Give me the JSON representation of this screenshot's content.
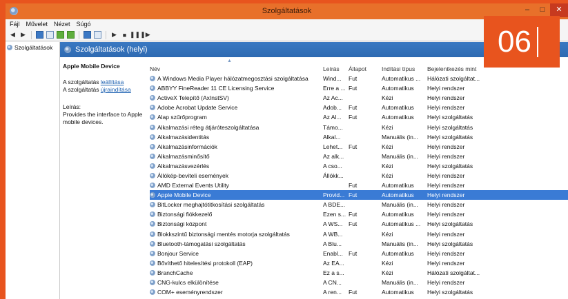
{
  "window": {
    "title": "Szolgáltatások",
    "controls": [
      "–",
      "□",
      "✕"
    ]
  },
  "menu": [
    "Fájl",
    "Művelet",
    "Nézet",
    "Súgó"
  ],
  "tree": {
    "item": "Szolgáltatások"
  },
  "header": {
    "title": "Szolgáltatások (helyi)"
  },
  "description": {
    "service_name": "Apple Mobile Device",
    "stop_prefix": "A szolgáltatás ",
    "stop_link": "leállítása",
    "restart_prefix": "A szolgáltatás ",
    "restart_link": "újraindítása",
    "desc_label": "Leírás:",
    "desc_text": "Provides the interface to Apple mobile devices."
  },
  "columns": [
    "Név",
    "Leírás",
    "Állapot",
    "Indítási típus",
    "Bejelentkezés mint"
  ],
  "rows": [
    {
      "name": "A Windows Media Player hálózatmegosztási szolgáltatása",
      "desc": "Wind...",
      "status": "Fut",
      "startup": "Automatikus ...",
      "logon": "Hálózati szolgáltat..."
    },
    {
      "name": "ABBYY FineReader 11 CE Licensing Service",
      "desc": "Erre a ...",
      "status": "Fut",
      "startup": "Automatikus",
      "logon": "Helyi rendszer"
    },
    {
      "name": "ActiveX Telepítő (AxInstSV)",
      "desc": "Az Ac...",
      "status": "",
      "startup": "Kézi",
      "logon": "Helyi rendszer"
    },
    {
      "name": "Adobe Acrobat Update Service",
      "desc": "Adob...",
      "status": "Fut",
      "startup": "Automatikus",
      "logon": "Helyi rendszer"
    },
    {
      "name": "Alap szűrőprogram",
      "desc": "Az Al...",
      "status": "Fut",
      "startup": "Automatikus",
      "logon": "Helyi szolgáltatás"
    },
    {
      "name": "Alkalmazási réteg átjáróteszolgáltatása",
      "desc": "Támo...",
      "status": "",
      "startup": "Kézi",
      "logon": "Helyi szolgáltatás"
    },
    {
      "name": "Alkalmazásidentitás",
      "desc": "Alkal...",
      "status": "",
      "startup": "Manuális (in...",
      "logon": "Helyi szolgáltatás"
    },
    {
      "name": "Alkalmazásinformációk",
      "desc": "Lehet...",
      "status": "Fut",
      "startup": "Kézi",
      "logon": "Helyi rendszer"
    },
    {
      "name": "Alkalmazásminősítő",
      "desc": "Az alk...",
      "status": "",
      "startup": "Manuális (in...",
      "logon": "Helyi rendszer"
    },
    {
      "name": "Alkalmazásvezérlés",
      "desc": "A cso...",
      "status": "",
      "startup": "Kézi",
      "logon": "Helyi szolgáltatás"
    },
    {
      "name": "Állókép-beviteli események",
      "desc": "Állókk...",
      "status": "",
      "startup": "Kézi",
      "logon": "Helyi rendszer"
    },
    {
      "name": "AMD External Events Utility",
      "desc": "",
      "status": "Fut",
      "startup": "Automatikus",
      "logon": "Helyi rendszer"
    },
    {
      "name": "Apple Mobile Device",
      "desc": "Provid...",
      "status": "Fut",
      "startup": "Automatikus",
      "logon": "Helyi rendszer",
      "selected": true
    },
    {
      "name": "BitLocker meghajtótitkosítási szolgáltatás",
      "desc": "A BDE...",
      "status": "",
      "startup": "Manuális (in...",
      "logon": "Helyi rendszer"
    },
    {
      "name": "Biztonsági fiókkezelő",
      "desc": "Ezen s...",
      "status": "Fut",
      "startup": "Automatikus",
      "logon": "Helyi rendszer"
    },
    {
      "name": "Biztonsági központ",
      "desc": "A WS...",
      "status": "Fut",
      "startup": "Automatikus ...",
      "logon": "Helyi szolgáltatás"
    },
    {
      "name": "Blokkszintű biztonsági mentés motorja szolgáltatás",
      "desc": "A WB...",
      "status": "",
      "startup": "Kézi",
      "logon": "Helyi rendszer"
    },
    {
      "name": "Bluetooth-támogatási szolgáltatás",
      "desc": "A Blu...",
      "status": "",
      "startup": "Manuális (in...",
      "logon": "Helyi szolgáltatás"
    },
    {
      "name": "Bonjour Service",
      "desc": "Enabl...",
      "status": "Fut",
      "startup": "Automatikus",
      "logon": "Helyi rendszer"
    },
    {
      "name": "Bővíthető hitelesítési protokoll (EAP)",
      "desc": "Az EA...",
      "status": "",
      "startup": "Kézi",
      "logon": "Helyi rendszer"
    },
    {
      "name": "BranchCache",
      "desc": "Ez a s...",
      "status": "",
      "startup": "Kézi",
      "logon": "Hálózati szolgáltat..."
    },
    {
      "name": "CNG-kulcs elkülönítése",
      "desc": "A CN...",
      "status": "",
      "startup": "Manuális (in...",
      "logon": "Helyi rendszer"
    },
    {
      "name": "COM+ eseményrendszer",
      "desc": "A ren...",
      "status": "Fut",
      "startup": "Automatikus",
      "logon": "Helyi szolgáltatás"
    }
  ],
  "badge": {
    "number": "06"
  },
  "colors": {
    "accent": "#e8541e",
    "selection": "#3a7bd5",
    "header": "#2e6ab2"
  }
}
